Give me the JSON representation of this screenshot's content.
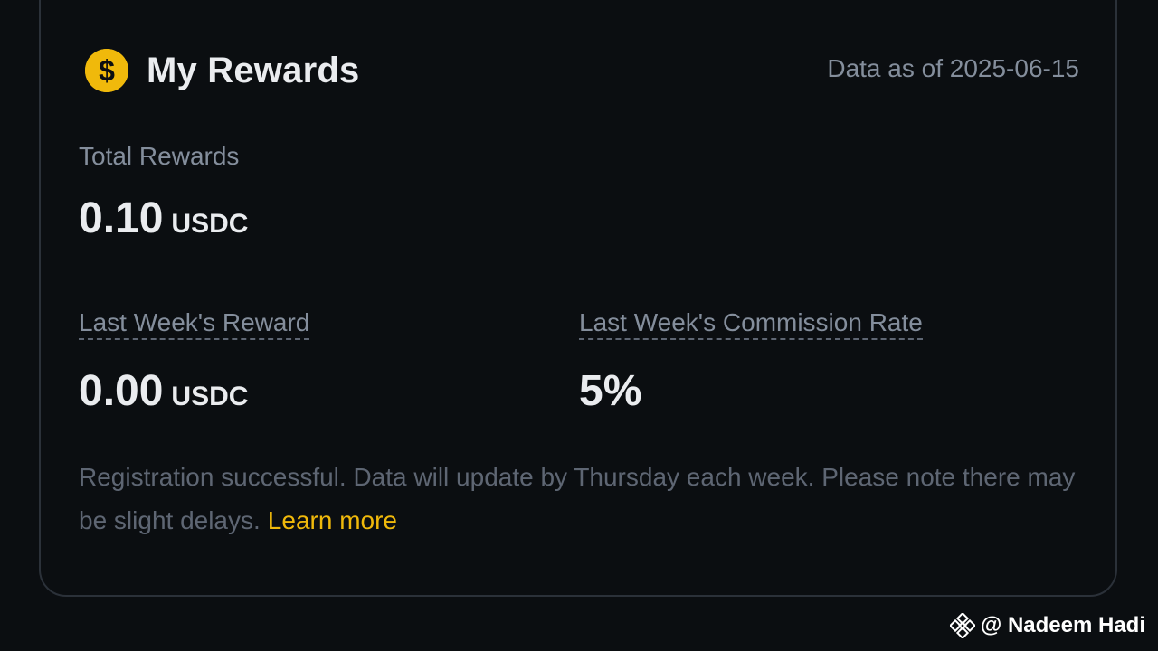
{
  "header": {
    "title": "My Rewards",
    "coin_icon": "dollar-coin-icon",
    "date_text": "Data as of 2025-06-15"
  },
  "total": {
    "label": "Total Rewards",
    "value": "0.10",
    "unit": "USDC"
  },
  "last_week_reward": {
    "label": "Last Week's Reward",
    "value": "0.00",
    "unit": "USDC"
  },
  "commission_rate": {
    "label": "Last Week's Commission Rate",
    "value": "5%"
  },
  "note": {
    "text": "Registration successful. Data will update by Thursday each week. Please note there may be slight delays.",
    "link_label": "Learn more"
  },
  "watermark": {
    "text": "@ Nadeem Hadi",
    "icon": "binance-logo-icon"
  },
  "colors": {
    "background": "#0b0e11",
    "accent": "#f0b90b",
    "muted_text": "#848e9c",
    "primary_text": "#eaecef"
  }
}
